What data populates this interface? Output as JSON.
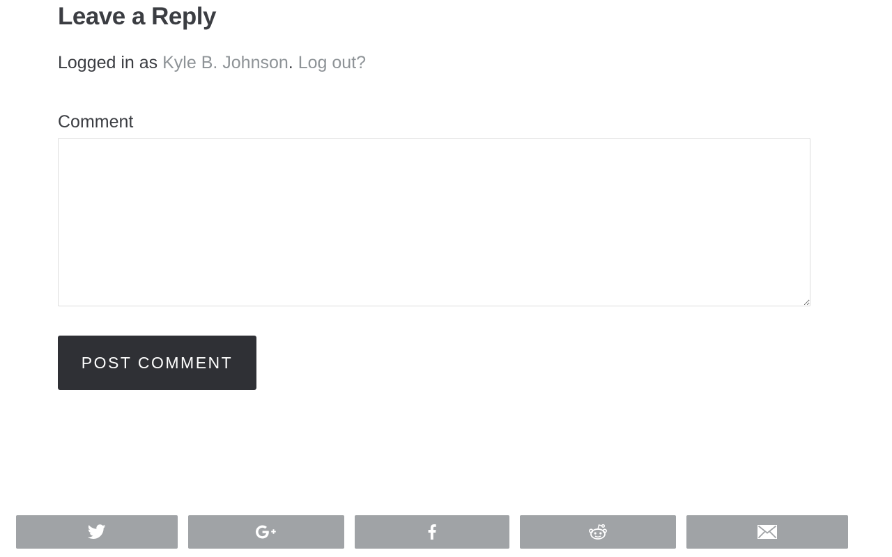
{
  "reply": {
    "title": "Leave a Reply",
    "logged_in_prefix": "Logged in as ",
    "user_name": "Kyle B. Johnson",
    "separator": ". ",
    "logout_label": "Log out?"
  },
  "comment": {
    "label": "Comment",
    "value": "",
    "placeholder": ""
  },
  "post_button": {
    "label": "POST COMMENT"
  },
  "share_bar": {
    "buttons": [
      {
        "network": "twitter",
        "icon": "twitter-icon"
      },
      {
        "network": "google-plus",
        "icon": "google-plus-icon"
      },
      {
        "network": "facebook",
        "icon": "facebook-icon"
      },
      {
        "network": "reddit",
        "icon": "reddit-icon"
      },
      {
        "network": "email",
        "icon": "email-icon"
      }
    ],
    "button_color": "#a0a3a6",
    "icon_color": "#ffffff"
  },
  "colors": {
    "text": "#3b3d42",
    "link": "#8e9397",
    "button_bg": "#2f3035"
  }
}
